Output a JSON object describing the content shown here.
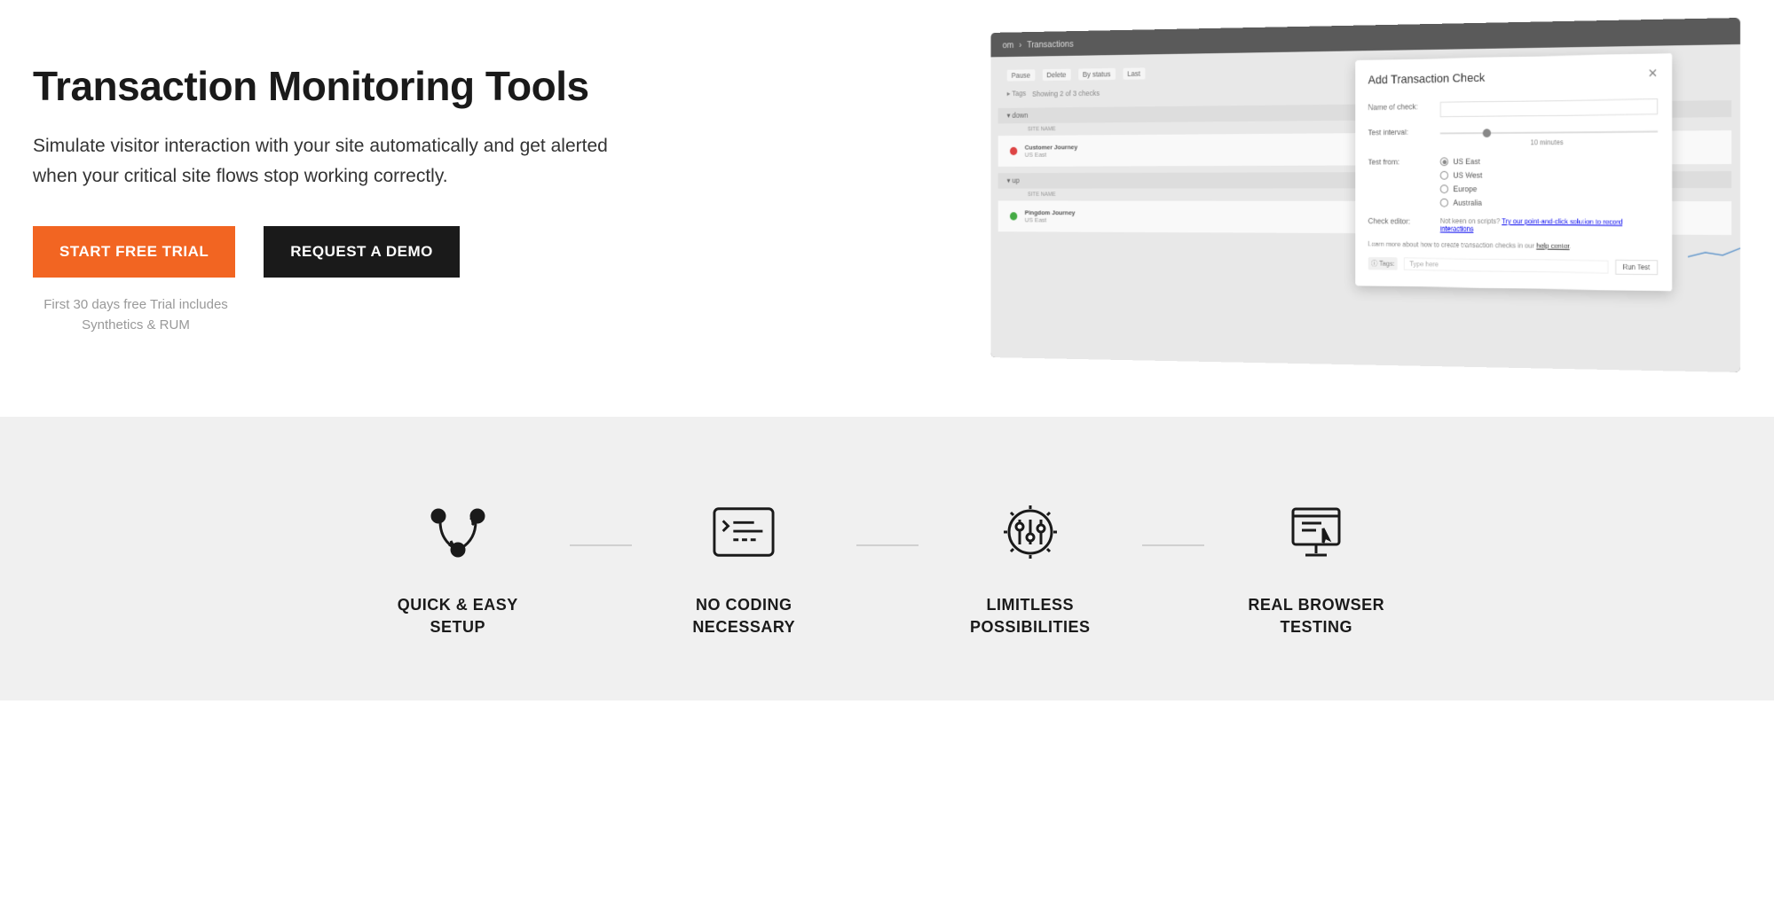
{
  "hero": {
    "title": "Transaction Monitoring Tools",
    "description": "Simulate visitor interaction with your site automatically and get alerted when your critical site flows stop working correctly.",
    "cta_primary": "START FREE TRIAL",
    "cta_secondary": "REQUEST A DEMO",
    "trial_note": "First 30 days free Trial includes Synthetics & RUM"
  },
  "screenshot": {
    "breadcrumb_prefix": "om",
    "breadcrumb_current": "Transactions",
    "filters": {
      "pause": "Pause",
      "delete": "Delete",
      "by_status": "By status",
      "last": "Last"
    },
    "tags_label": "Tags",
    "showing": "Showing 2 of 3 checks",
    "section_down": "down",
    "section_up": "up",
    "col_site": "SITE NAME",
    "checks": [
      {
        "name": "Customer Journey",
        "region": "US East"
      },
      {
        "name": "Pingdom Journey",
        "region": "US East"
      }
    ],
    "modal": {
      "title": "Add Transaction Check",
      "label_name": "Name of check:",
      "label_interval": "Test interval:",
      "interval_value": "10 minutes",
      "label_from": "Test from:",
      "regions": [
        "US East",
        "US West",
        "Europe",
        "Australia"
      ],
      "selected_region": "US East",
      "label_editor": "Check editor:",
      "hint_prefix": "Not keen on scripts?",
      "hint_link": "Try our point-and-click solution to record interactions",
      "help_prefix": "Learn more about how to create transaction checks in our",
      "help_link": "help center",
      "tags_label": "Tags:",
      "type_here": "Type here",
      "run_test": "Run Test"
    }
  },
  "features": [
    {
      "label_line1": "QUICK & EASY",
      "label_line2": "SETUP"
    },
    {
      "label_line1": "NO CODING",
      "label_line2": "NECESSARY"
    },
    {
      "label_line1": "LIMITLESS",
      "label_line2": "POSSIBILITIES"
    },
    {
      "label_line1": "REAL BROWSER",
      "label_line2": "TESTING"
    }
  ]
}
